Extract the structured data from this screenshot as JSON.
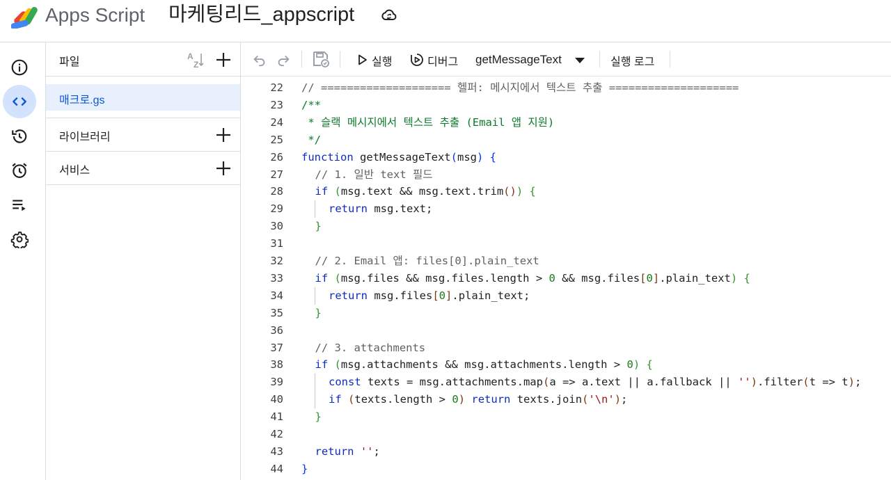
{
  "header": {
    "app_name": "Apps Script",
    "project_title": "마케팅리드_appscript",
    "cloud_icon": "cloud-sync-icon",
    "logo_colors": [
      "#4285f4",
      "#ea4335",
      "#fbbc04",
      "#34a853"
    ]
  },
  "rail": {
    "items": [
      {
        "name": "overview",
        "icon": "info-icon",
        "active": false
      },
      {
        "name": "editor",
        "icon": "code-icon",
        "active": true
      },
      {
        "name": "versions",
        "icon": "history-icon",
        "active": false
      },
      {
        "name": "triggers",
        "icon": "alarm-icon",
        "active": false
      },
      {
        "name": "executions",
        "icon": "executions-list-icon",
        "active": false
      },
      {
        "name": "settings",
        "icon": "gear-icon",
        "active": false
      }
    ],
    "active_color": "#d3e3fd"
  },
  "files_panel": {
    "title": "파일",
    "sort_icon": "sort-az-icon",
    "files": [
      {
        "name": "매크로.gs"
      }
    ],
    "libraries_label": "라이브러리",
    "services_label": "서비스"
  },
  "toolbar": {
    "undo_icon": "undo-icon",
    "redo_icon": "redo-icon",
    "save_icon": "save-icon",
    "run_label": "실행",
    "debug_label": "디버그",
    "function_selected": "getMessageText",
    "log_label": "실행 로그"
  },
  "editor": {
    "lines": [
      {
        "n": "22",
        "indent": 0,
        "tokens": [
          {
            "t": "// ==================== 헬퍼: 메시지에서 텍스트 추출 ====================",
            "c": "comment"
          }
        ]
      },
      {
        "n": "23",
        "indent": 0,
        "tokens": [
          {
            "t": "/**",
            "c": "doc"
          }
        ]
      },
      {
        "n": "24",
        "indent": 0,
        "tokens": [
          {
            "t": " * 슬랙 메시지에서 텍스트 추출 (Email 앱 지원)",
            "c": "doc"
          }
        ]
      },
      {
        "n": "25",
        "indent": 0,
        "tokens": [
          {
            "t": " */",
            "c": "doc"
          }
        ]
      },
      {
        "n": "26",
        "indent": 0,
        "tokens": [
          {
            "t": "function",
            "c": "kw"
          },
          {
            "t": " getMessageText",
            "c": ""
          },
          {
            "t": "(",
            "c": "p1"
          },
          {
            "t": "msg",
            "c": ""
          },
          {
            "t": ")",
            "c": "p1"
          },
          {
            "t": " ",
            "c": ""
          },
          {
            "t": "{",
            "c": "p1"
          }
        ]
      },
      {
        "n": "27",
        "indent": 1,
        "tokens": [
          {
            "t": "// 1. 일반 text 필드",
            "c": "comment"
          }
        ]
      },
      {
        "n": "28",
        "indent": 1,
        "tokens": [
          {
            "t": "if",
            "c": "kw"
          },
          {
            "t": " ",
            "c": ""
          },
          {
            "t": "(",
            "c": "p2"
          },
          {
            "t": "msg.text && msg.text.trim",
            "c": ""
          },
          {
            "t": "()",
            "c": "p3"
          },
          {
            "t": ")",
            "c": "p2"
          },
          {
            "t": " ",
            "c": ""
          },
          {
            "t": "{",
            "c": "p2"
          }
        ]
      },
      {
        "n": "29",
        "indent": 2,
        "tokens": [
          {
            "t": "return",
            "c": "kw"
          },
          {
            "t": " msg.text;",
            "c": ""
          }
        ]
      },
      {
        "n": "30",
        "indent": 1,
        "tokens": [
          {
            "t": "}",
            "c": "p2"
          }
        ]
      },
      {
        "n": "31",
        "indent": 0,
        "tokens": []
      },
      {
        "n": "32",
        "indent": 1,
        "tokens": [
          {
            "t": "// 2. Email 앱: files[0].plain_text",
            "c": "comment"
          }
        ]
      },
      {
        "n": "33",
        "indent": 1,
        "tokens": [
          {
            "t": "if",
            "c": "kw"
          },
          {
            "t": " ",
            "c": ""
          },
          {
            "t": "(",
            "c": "p2"
          },
          {
            "t": "msg.files && msg.files.length > ",
            "c": ""
          },
          {
            "t": "0",
            "c": "num"
          },
          {
            "t": " && msg.files",
            "c": ""
          },
          {
            "t": "[",
            "c": "p3"
          },
          {
            "t": "0",
            "c": "num"
          },
          {
            "t": "]",
            "c": "p3"
          },
          {
            "t": ".plain_text",
            "c": ""
          },
          {
            "t": ")",
            "c": "p2"
          },
          {
            "t": " ",
            "c": ""
          },
          {
            "t": "{",
            "c": "p2"
          }
        ]
      },
      {
        "n": "34",
        "indent": 2,
        "tokens": [
          {
            "t": "return",
            "c": "kw"
          },
          {
            "t": " msg.files",
            "c": ""
          },
          {
            "t": "[",
            "c": "p3"
          },
          {
            "t": "0",
            "c": "num"
          },
          {
            "t": "]",
            "c": "p3"
          },
          {
            "t": ".plain_text;",
            "c": ""
          }
        ]
      },
      {
        "n": "35",
        "indent": 1,
        "tokens": [
          {
            "t": "}",
            "c": "p2"
          }
        ]
      },
      {
        "n": "36",
        "indent": 0,
        "tokens": []
      },
      {
        "n": "37",
        "indent": 1,
        "tokens": [
          {
            "t": "// 3. attachments",
            "c": "comment"
          }
        ]
      },
      {
        "n": "38",
        "indent": 1,
        "tokens": [
          {
            "t": "if",
            "c": "kw"
          },
          {
            "t": " ",
            "c": ""
          },
          {
            "t": "(",
            "c": "p2"
          },
          {
            "t": "msg.attachments && msg.attachments.length > ",
            "c": ""
          },
          {
            "t": "0",
            "c": "num"
          },
          {
            "t": ")",
            "c": "p2"
          },
          {
            "t": " ",
            "c": ""
          },
          {
            "t": "{",
            "c": "p2"
          }
        ]
      },
      {
        "n": "39",
        "indent": 2,
        "tokens": [
          {
            "t": "const",
            "c": "kw"
          },
          {
            "t": " texts = msg.attachments.map",
            "c": ""
          },
          {
            "t": "(",
            "c": "p3"
          },
          {
            "t": "a => a.text || a.fallback || ",
            "c": ""
          },
          {
            "t": "''",
            "c": "str"
          },
          {
            "t": ")",
            "c": "p3"
          },
          {
            "t": ".filter",
            "c": ""
          },
          {
            "t": "(",
            "c": "p3"
          },
          {
            "t": "t => t",
            "c": ""
          },
          {
            "t": ")",
            "c": "p3"
          },
          {
            "t": ";",
            "c": ""
          }
        ]
      },
      {
        "n": "40",
        "indent": 2,
        "tokens": [
          {
            "t": "if",
            "c": "kw"
          },
          {
            "t": " ",
            "c": ""
          },
          {
            "t": "(",
            "c": "p3"
          },
          {
            "t": "texts.length > ",
            "c": ""
          },
          {
            "t": "0",
            "c": "num"
          },
          {
            "t": ")",
            "c": "p3"
          },
          {
            "t": " ",
            "c": ""
          },
          {
            "t": "return",
            "c": "kw"
          },
          {
            "t": " texts.join",
            "c": ""
          },
          {
            "t": "(",
            "c": "p3"
          },
          {
            "t": "'\\n'",
            "c": "str"
          },
          {
            "t": ")",
            "c": "p3"
          },
          {
            "t": ";",
            "c": ""
          }
        ]
      },
      {
        "n": "41",
        "indent": 1,
        "tokens": [
          {
            "t": "}",
            "c": "p2"
          }
        ]
      },
      {
        "n": "42",
        "indent": 0,
        "tokens": []
      },
      {
        "n": "43",
        "indent": 1,
        "tokens": [
          {
            "t": "return",
            "c": "kw"
          },
          {
            "t": " ",
            "c": ""
          },
          {
            "t": "''",
            "c": "str"
          },
          {
            "t": ";",
            "c": ""
          }
        ]
      },
      {
        "n": "44",
        "indent": 0,
        "tokens": [
          {
            "t": "}",
            "c": "p1"
          }
        ]
      }
    ]
  }
}
